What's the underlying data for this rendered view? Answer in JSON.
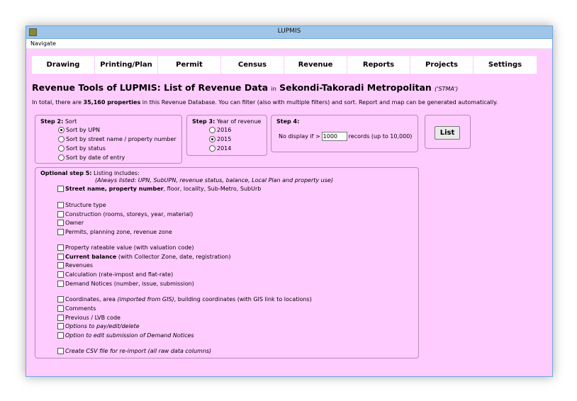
{
  "window": {
    "title": "LUPMIS"
  },
  "menubar": {
    "navigate": "Navigate"
  },
  "tabs": [
    "Drawing",
    "Printing/Plan",
    "Permit",
    "Census",
    "Revenue",
    "Reports",
    "Projects",
    "Settings"
  ],
  "heading": {
    "main": "Revenue Tools of LUPMIS: List of Revenue Data",
    "in": "in",
    "place": "Sekondi-Takoradi Metropolitan",
    "abbr": "('STMA')"
  },
  "summary": {
    "prefix": "In total, there are",
    "count": "35,160 properties",
    "suffix": "in this Revenue Database. You can filter (also with multiple filters) and sort. Report and map can be generated automatically."
  },
  "step2": {
    "label": "Step 2:",
    "title": "Sort",
    "options": [
      "Sort by UPN",
      "Sort by street name / property number",
      "Sort by status",
      "Sort by date of entry"
    ],
    "selected_index": 0
  },
  "step3": {
    "label": "Step 3:",
    "title": "Year of revenue",
    "options": [
      "2016",
      "2015",
      "2014"
    ],
    "selected_index": 1
  },
  "step4": {
    "label": "Step 4:",
    "prefix": "No display if >",
    "value": "1000",
    "suffix": "records (up to 10,000)"
  },
  "list_button": "List",
  "step5": {
    "label": "Optional step 5:",
    "title": "Listing includes:",
    "note": "(Always listed: UPN, SubUPN, revenue status, balance, Local Plan and property use)",
    "items": {
      "street_bold": "Street name, property number",
      "street_rest": ", floor, locality, Sub-Metro, SubUrb",
      "structure": "Structure type",
      "construction": "Construction (rooms, storeys, year, material)",
      "owner": "Owner",
      "permits": "Permits, planning zone, revenue zone",
      "rateable": "Property rateable value (with valuation code)",
      "balance_bold": "Current balance",
      "balance_rest": "(with Collector Zone, date, registration)",
      "revenues": "Revenues",
      "calculation": "Calculation (rate-impost and flat-rate)",
      "demand": "Demand Notices (number, issue, submission)",
      "coords_a": "Coordinates, area",
      "coords_i": "(imported from GIS)",
      "coords_b": ", building coordinates (with GIS link to locations)",
      "comments": "Comments",
      "lvb": "Previous / LVB code",
      "pay": "Options to pay/edit/delete",
      "edit_demand": "Option to edit submission of Demand Notices",
      "csv": "Create CSV file for re-import (all raw data columns)"
    }
  }
}
